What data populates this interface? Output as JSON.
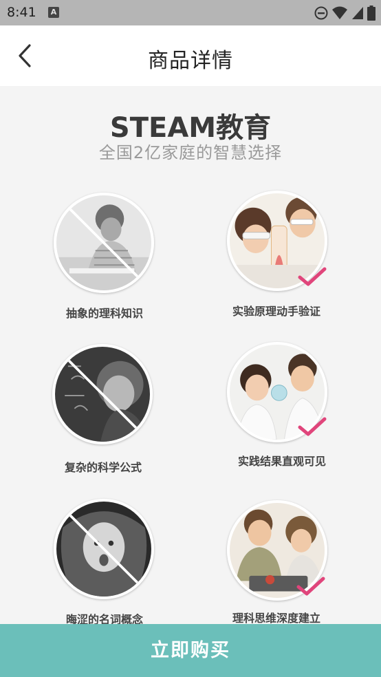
{
  "status_bar": {
    "time": "8:41",
    "notification_icon": "A",
    "icons": [
      "dnd-icon",
      "wifi-icon",
      "signal-icon",
      "battery-icon"
    ]
  },
  "nav": {
    "back_icon": "chevron-left-icon",
    "title": "商品详情"
  },
  "hero": {
    "title": "STEAM教育",
    "subtitle": "全国2亿家庭的智慧选择"
  },
  "comparisons": [
    {
      "bad_label": "抽象的理科知识",
      "good_label": "实验原理动手验证"
    },
    {
      "bad_label": "复杂的科学公式",
      "good_label": "实践结果直观可见"
    },
    {
      "bad_label": "晦涩的名词概念",
      "good_label": "理科思维深度建立"
    }
  ],
  "buy_button": {
    "label": "立即购买"
  },
  "colors": {
    "accent": "#6bbfba",
    "check": "#e0457b",
    "status_bar": "#b5b5b5",
    "content_bg": "#f4f4f4"
  }
}
